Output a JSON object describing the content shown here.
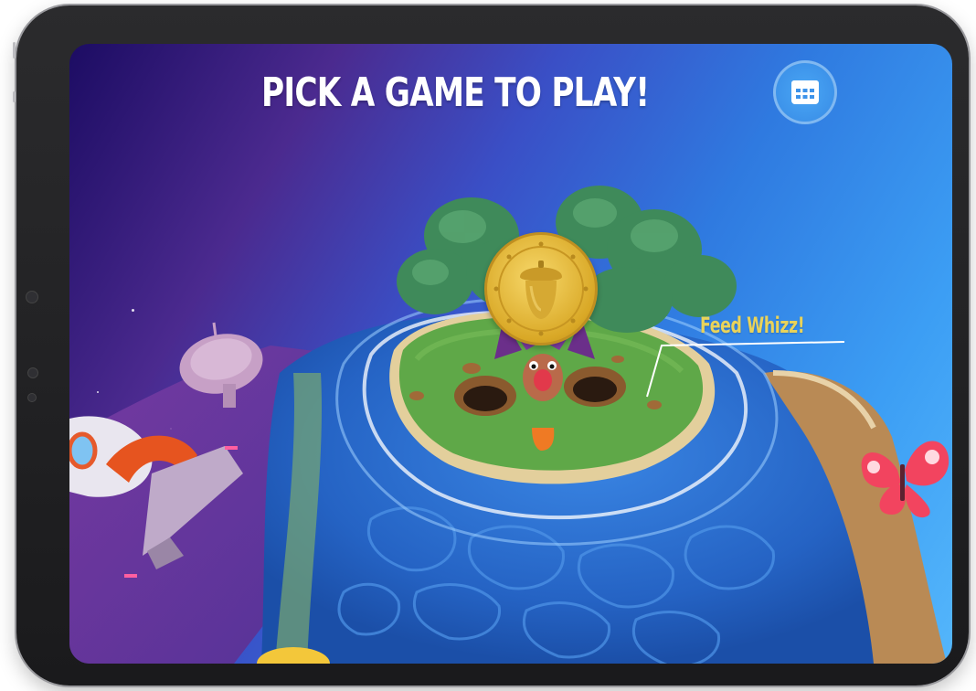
{
  "screen": {
    "title": "PICK A GAME TO PLAY!"
  },
  "header": {
    "menu_button_icon": "calendar-grid-icon"
  },
  "world": {
    "game_label": "Feed Whizz!",
    "badge_icon": "acorn-medal-icon",
    "colors": {
      "sky_dark": "#1c0c63",
      "sky_light": "#54b6fb",
      "water": "#2e6fd1",
      "grass": "#5fa848",
      "label": "#e9d35a",
      "medal": "#d9a826"
    }
  }
}
